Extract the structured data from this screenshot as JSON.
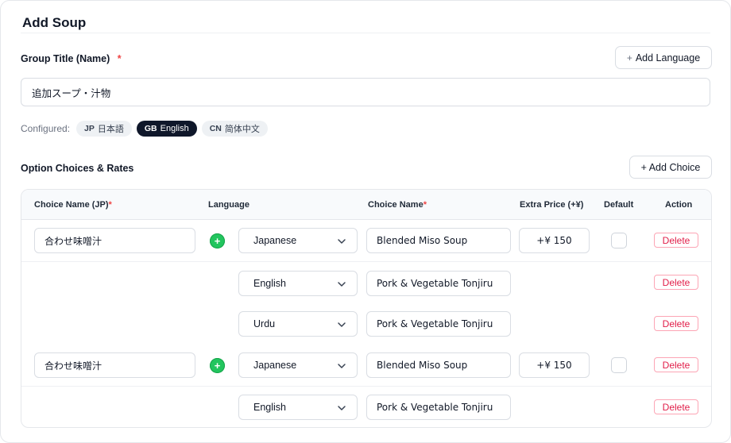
{
  "page": {
    "title": "Add Soup"
  },
  "group": {
    "label": "Group Title (Name)",
    "required_mark": "*",
    "value": "追加スープ・汁物",
    "add_language_label": "Add Language",
    "plus": "+"
  },
  "configured": {
    "label": "Configured:",
    "chips": [
      {
        "code": "JP",
        "name": "日本語",
        "active": false
      },
      {
        "code": "GB",
        "name": "English",
        "active": true
      },
      {
        "code": "CN",
        "name": "简体中文",
        "active": false
      }
    ]
  },
  "options": {
    "label": "Option Choices & Rates",
    "add_choice_label": "+ Add Choice"
  },
  "table": {
    "headers": {
      "choice_name_jp": "Choice Name (JP)",
      "language": "Language",
      "choice_name": "Choice Name",
      "extra_price": "Extra Price (+¥)",
      "default": "Default",
      "action": "Action",
      "required_mark": "*"
    },
    "rows": [
      {
        "jp_name": "合わせ味噌汁",
        "language": "Japanese",
        "choice_name": "Blended Miso Soup",
        "price": "+¥ 150",
        "delete": "Delete"
      },
      {
        "language": "English",
        "choice_name": "Pork & Vegetable Tonjiru",
        "delete": "Delete"
      },
      {
        "language": "Urdu",
        "choice_name": "Pork & Vegetable Tonjiru",
        "delete": "Delete"
      },
      {
        "jp_name": "合わせ味噌汁",
        "language": "Japanese",
        "choice_name": "Blended Miso Soup",
        "price": "+¥ 150",
        "delete": "Delete"
      },
      {
        "language": "English",
        "choice_name": "Pork & Vegetable Tonjiru",
        "delete": "Delete"
      }
    ],
    "add_lang_symbol": "+"
  },
  "colors": {
    "accent_dark": "#0f172a",
    "danger": "#e11d48",
    "success": "#22c55e"
  },
  "icons": {
    "dropdown": "chevron-down-icon",
    "add": "plus-circle-icon"
  }
}
